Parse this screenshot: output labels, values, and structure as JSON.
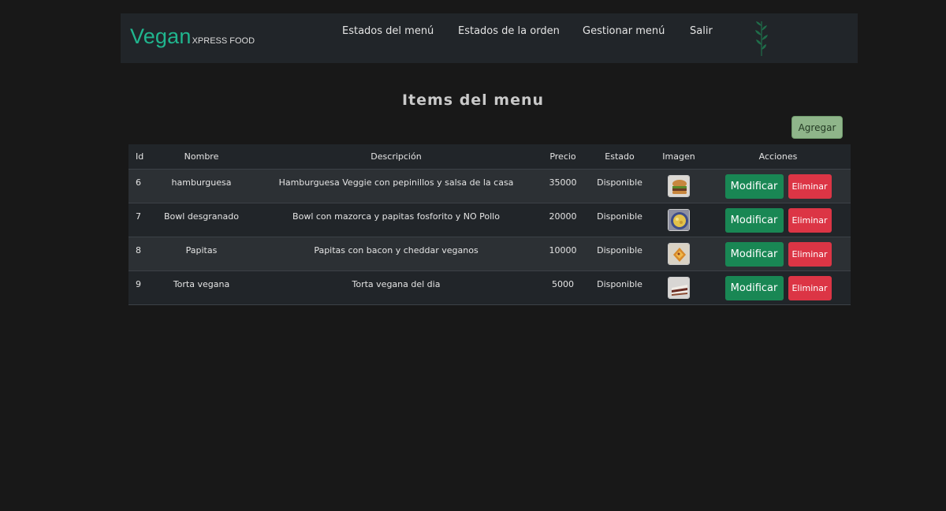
{
  "brand": {
    "main": "Vegan",
    "sub": "XPRESS FOOD"
  },
  "nav": {
    "links": [
      "Estados del menú",
      "Estados de la orden",
      "Gestionar menú",
      "Salir"
    ],
    "logo_icon": "herb-leaf-icon"
  },
  "page": {
    "title": "Items del menu",
    "add_label": "Agregar"
  },
  "table": {
    "headers": [
      "Id",
      "Nombre",
      "Descripción",
      "Precio",
      "Estado",
      "Imagen",
      "Acciones"
    ],
    "rows": [
      {
        "id": "6",
        "name": "hamburguesa",
        "description": "Hamburguesa Veggie con pepinillos y salsa de la casa",
        "price": "35000",
        "status": "Disponible",
        "image_icon": "burger-thumbnail"
      },
      {
        "id": "7",
        "name": "Bowl desgranado",
        "description": "Bowl con mazorca y papitas fosforito y NO Pollo",
        "price": "20000",
        "status": "Disponible",
        "image_icon": "bowl-thumbnail"
      },
      {
        "id": "8",
        "name": "Papitas",
        "description": "Papitas con bacon y cheddar veganos",
        "price": "10000",
        "status": "Disponible",
        "image_icon": "fries-thumbnail"
      },
      {
        "id": "9",
        "name": "Torta vegana",
        "description": "Torta vegana del dia",
        "price": "5000",
        "status": "Disponible",
        "image_icon": "cake-thumbnail"
      }
    ],
    "modify_label": "Modificar",
    "delete_label": "Eliminar"
  },
  "colors": {
    "brand": "#20b58e",
    "add_button": "#8fb58a",
    "modify_button": "#198754",
    "delete_button": "#dc3545",
    "navbar": "#212529",
    "background": "#181818"
  }
}
